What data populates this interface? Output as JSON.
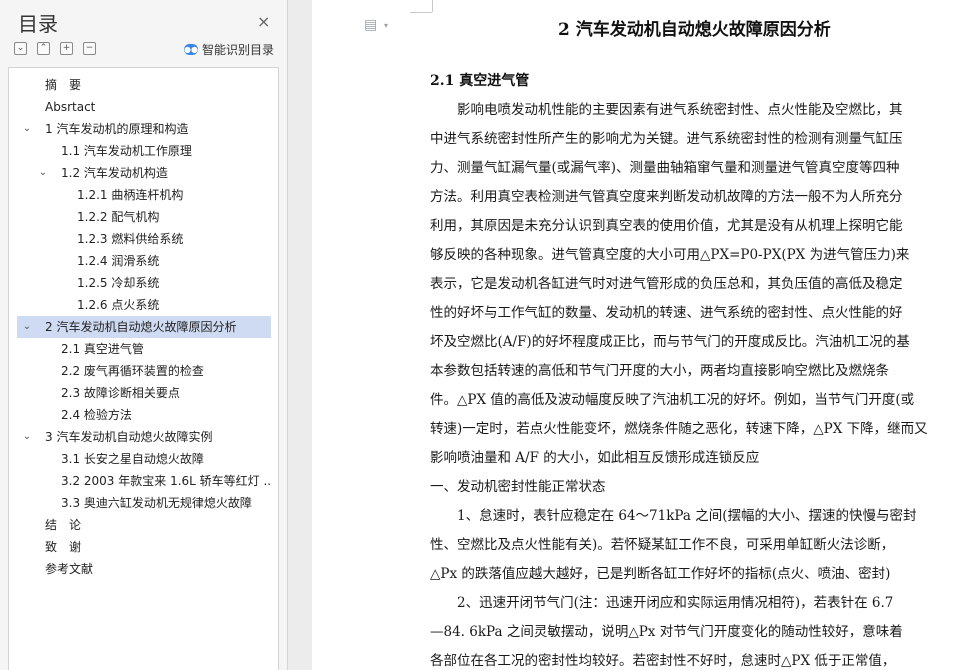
{
  "sidebar": {
    "title": "目录",
    "close_icon": "×",
    "tools": [
      "⌄",
      "⌃",
      "+",
      "−"
    ],
    "smart_label": "智能识别目录",
    "toc": [
      {
        "label": "摘　要",
        "level": 1,
        "chevron": ""
      },
      {
        "label": "Absrtact",
        "level": 1,
        "chevron": ""
      },
      {
        "label": "1  汽车发动机的原理和构造",
        "level": 1,
        "chevron": "⌄"
      },
      {
        "label": "1.1  汽车发动机工作原理",
        "level": 2,
        "chevron": ""
      },
      {
        "label": "1.2  汽车发动机构造",
        "level": 2,
        "chevron": "⌄"
      },
      {
        "label": "1.2.1  曲柄连杆机构",
        "level": 3,
        "chevron": ""
      },
      {
        "label": "1.2.2  配气机构",
        "level": 3,
        "chevron": ""
      },
      {
        "label": "1.2.3  燃料供给系统",
        "level": 3,
        "chevron": ""
      },
      {
        "label": "1.2.4  润滑系统",
        "level": 3,
        "chevron": ""
      },
      {
        "label": "1.2.5  冷却系统",
        "level": 3,
        "chevron": ""
      },
      {
        "label": "1.2.6  点火系统",
        "level": 3,
        "chevron": ""
      },
      {
        "label": "2  汽车发动机自动熄火故障原因分析",
        "level": 1,
        "chevron": "⌄",
        "active": true
      },
      {
        "label": "2.1  真空进气管",
        "level": 2,
        "chevron": ""
      },
      {
        "label": "2.2  废气再循环装置的检查",
        "level": 2,
        "chevron": ""
      },
      {
        "label": "2.3  故障诊断相关要点",
        "level": 2,
        "chevron": ""
      },
      {
        "label": "2.4  检验方法",
        "level": 2,
        "chevron": ""
      },
      {
        "label": "3  汽车发动机自动熄火故障实例",
        "level": 1,
        "chevron": "⌄"
      },
      {
        "label": "3.1  长安之星自动熄火故障",
        "level": 2,
        "chevron": ""
      },
      {
        "label": "3.2 2003 年款宝来 1.6L 轿车等红灯 ...",
        "level": 2,
        "chevron": ""
      },
      {
        "label": "3.3  奥迪六缸发动机无规律熄火故障",
        "level": 2,
        "chevron": ""
      },
      {
        "label": "结　论",
        "level": 1,
        "chevron": ""
      },
      {
        "label": "致　谢",
        "level": 1,
        "chevron": ""
      },
      {
        "label": "参考文献",
        "level": 1,
        "chevron": ""
      }
    ]
  },
  "document": {
    "doc_icon": "▤",
    "doc_icon_caret": "▾",
    "heading1": "2  汽车发动机自动熄火故障原因分析",
    "heading2": "2.1  真空进气管",
    "lines": [
      "　　影响电喷发动机性能的主要因素有进气系统密封性、点火性能及空燃比，其",
      "中进气系统密封性所产生的影响尤为关键。进气系统密封性的检测有测量气缸压",
      "力、测量气缸漏气量(或漏气率)、测量曲轴箱窜气量和测量进气管真空度等四种",
      "方法。利用真空表检测进气管真空度来判断发动机故障的方法一般不为人所充分",
      "利用，其原因是未充分认识到真空表的使用价值，尤其是没有从机理上探明它能",
      "够反映的各种现象。进气管真空度的大小可用△PX=P0-PX(PX 为进气管压力)来",
      "表示，它是发动机各缸进气时对进气管形成的负压总和，其负压值的高低及稳定",
      "性的好坏与工作气缸的数量、发动机的转速、进气系统的密封性、点火性能的好",
      "坏及空燃比(A/F)的好坏程度成正比，而与节气门的开度成反比。汽油机工况的基",
      "本参数包括转速的高低和节气门开度的大小，两者均直接影响空燃比及燃烧条",
      "件。△PX 值的高低及波动幅度反映了汽油机工况的好坏。例如，当节气门开度(或",
      "转速)一定时，若点火性能变坏，燃烧条件随之恶化，转速下降，△PX 下降，继而又",
      "影响喷油量和 A/F 的大小，如此相互反馈形成连锁反应",
      "一、发动机密封性能正常状态",
      "　　1、怠速时，表针应稳定在 64～71kPa 之间(摆幅的大小、摆速的快慢与密封",
      "性、空燃比及点火性能有关)。若怀疑某缸工作不良，可采用单缸断火法诊断，",
      "△Px 的跌落值应越大越好，已是判断各缸工作好坏的指标(点火、喷油、密封)",
      "　　2、迅速开闭节气门(注：迅速开闭应和实际运用情况相符)，若表针在 6.7",
      "—84. 6kPa 之间灵敏摆动，说明△Px 对节气门开度变化的随动性较好，意味着",
      "各部位在各工况的密封性均较好。若密封性不好时，怠速时△PX 低于正常值，"
    ]
  }
}
